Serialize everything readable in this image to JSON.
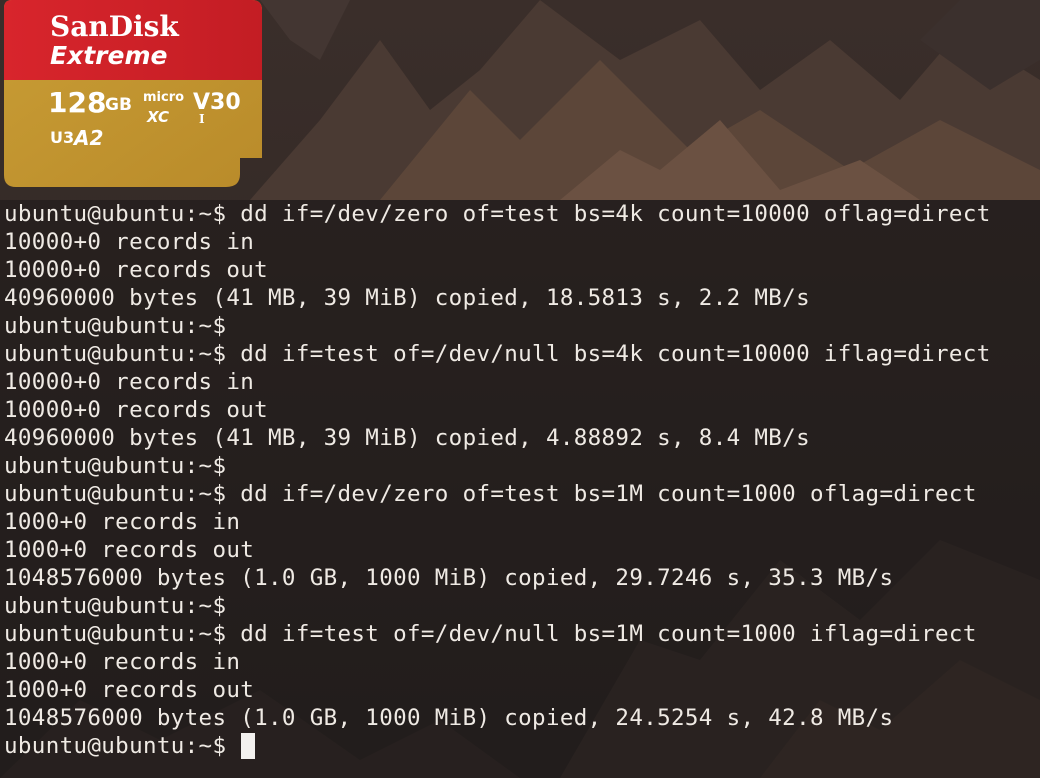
{
  "sdcard": {
    "brand": "SanDisk",
    "line": "Extreme",
    "capacity": "128",
    "capacity_unit": "GB",
    "micro": "micro",
    "sdxc": "XC",
    "class": "V30",
    "uhs": "I",
    "u_class": "U3",
    "app_class": "A2",
    "colors": {
      "top": "#d32229",
      "bottom": "#c9a23a"
    }
  },
  "terminal": {
    "lines": [
      "ubuntu@ubuntu:~$ dd if=/dev/zero of=test bs=4k count=10000 oflag=direct",
      "10000+0 records in",
      "10000+0 records out",
      "40960000 bytes (41 MB, 39 MiB) copied, 18.5813 s, 2.2 MB/s",
      "ubuntu@ubuntu:~$",
      "ubuntu@ubuntu:~$ dd if=test of=/dev/null bs=4k count=10000 iflag=direct",
      "10000+0 records in",
      "10000+0 records out",
      "40960000 bytes (41 MB, 39 MiB) copied, 4.88892 s, 8.4 MB/s",
      "ubuntu@ubuntu:~$",
      "ubuntu@ubuntu:~$ dd if=/dev/zero of=test bs=1M count=1000 oflag=direct",
      "1000+0 records in",
      "1000+0 records out",
      "1048576000 bytes (1.0 GB, 1000 MiB) copied, 29.7246 s, 35.3 MB/s",
      "ubuntu@ubuntu:~$",
      "ubuntu@ubuntu:~$ dd if=test of=/dev/null bs=1M count=1000 iflag=direct",
      "1000+0 records in",
      "1000+0 records out",
      "1048576000 bytes (1.0 GB, 1000 MiB) copied, 24.5254 s, 42.8 MB/s"
    ],
    "prompt": "ubuntu@ubuntu:~$ "
  }
}
